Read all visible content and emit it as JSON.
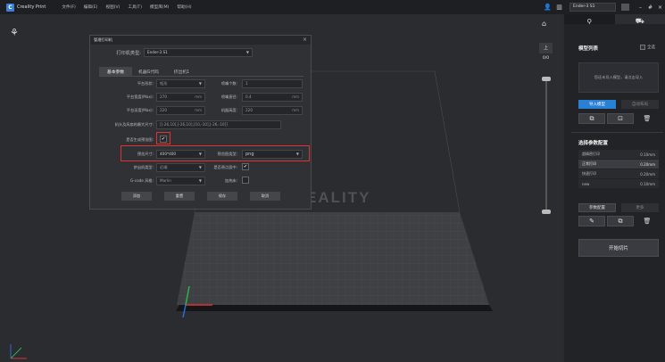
{
  "titlebar": {
    "app_name": "Creality Print",
    "menus": [
      "文件(F)",
      "编辑(E)",
      "视图(V)",
      "工具(T)",
      "模型库(M)",
      "帮助(H)"
    ],
    "printer": "Ender-3 S1"
  },
  "viewport": {
    "up_label": "上",
    "layer_num": "0/0",
    "watermark": "EALITY"
  },
  "right_panel": {
    "model_list_title": "模型列表",
    "select_all": "全选",
    "empty_hint": "您还未导入模型，请点击导入",
    "import_btn": "导入模型",
    "auto_layout_btn": "自动布局",
    "config_title": "选择参数配置",
    "configs": [
      {
        "name": "超精密打印",
        "value": "0.10mm"
      },
      {
        "name": "正常打印",
        "value": "0.20mm"
      },
      {
        "name": "快速打印",
        "value": "0.20mm"
      },
      {
        "name": "new",
        "value": "0.10mm"
      }
    ],
    "manage_btn": "参数配置",
    "more_btn": "更多",
    "slice_btn": "开始切片"
  },
  "dialog": {
    "title": "管理打印机",
    "printer_type_label": "打印机类型:",
    "printer_type": "Ender-3 S1",
    "tabs": [
      "基本参数",
      "机器G代码",
      "挤出机1"
    ],
    "plate_shape_label": "平台形状:",
    "plate_shape": "矩形",
    "width_label": "平台宽度(Max):",
    "width": "270",
    "depth_label": "平台深度(Max):",
    "depth": "220",
    "unit": "mm",
    "nozzles_label": "喷嘴个数:",
    "nozzles": "1",
    "nozzle_dia_label": "喷嘴直径:",
    "nozzle_dia": "0.4",
    "height_label": "机器高度:",
    "height": "220",
    "head_label": "机头及风扇的最大尺寸:",
    "head_value": "[[-26,10],[-26,10],[10,-10],[-26,-10]]",
    "preview_label": "是否生成预览图:",
    "preview_checked": "✔",
    "preview_size_label": "预览尺寸:",
    "preview_size": "400*400",
    "preview_format_label": "预览图类型:",
    "preview_format": "png",
    "extruder_type_label": "挤出机类型:",
    "extruder_type": "近端",
    "center_origin_label": "是否原点居中:",
    "center_checked": "✔",
    "gcode_label": "G-code 风格:",
    "gcode_style": "Marlin",
    "heated_bed_label": "加热床:",
    "buttons": [
      "添加",
      "重置",
      "保存",
      "取消"
    ]
  }
}
